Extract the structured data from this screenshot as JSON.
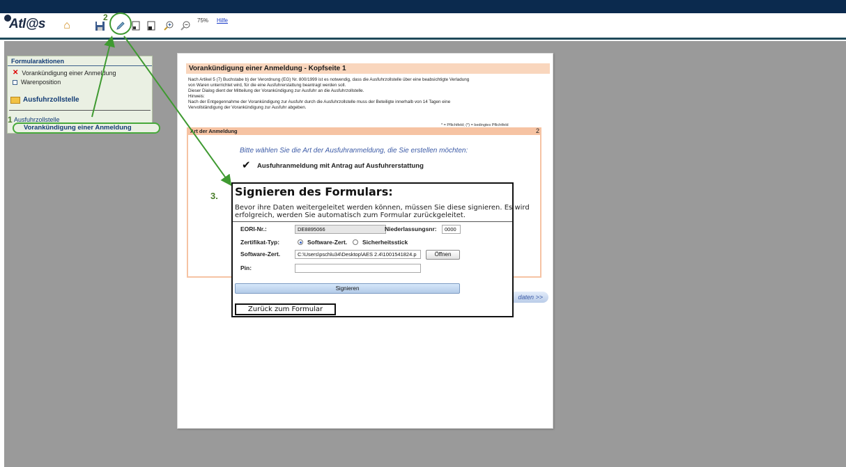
{
  "app": {
    "logo": "Atl@s"
  },
  "toolbar": {
    "zoom": "75%",
    "help": "Hilfe"
  },
  "sidebar": {
    "header": "Formularaktionen",
    "items": [
      {
        "label": "Vorankündigung einer Anmeldung",
        "icon": "delete-x-icon"
      },
      {
        "label": "Warenposition",
        "icon": "checkbox-icon"
      }
    ],
    "section": "Ausfuhrzollstelle",
    "tree_parent": "Ausfuhrzollstelle",
    "tree_active": "Vorankündigung einer Anmeldung"
  },
  "callouts": {
    "one": "1",
    "two": "2",
    "three": "3."
  },
  "document": {
    "title": "Vorankündigung einer Anmeldung - Kopfseite 1",
    "paragraphs": [
      "Nach Artikel 5 (7) Buchstabe b) der Verordnung (EG) Nr. 800/1999 ist es notwendig, dass die Ausfuhrzollstelle über eine beabsichtigte Verladung",
      "von Waren unterrichtet wird, für die eine Ausfuhrerstattung beantragt werden soll.",
      "Dieser Dialog dient der Mitteilung der Vorankündigung zur Ausfuhr an die Ausfuhrzollstelle.",
      "Hinweis:",
      "Nach der Entgegennahme der Vorankündigung zur Ausfuhr durch die Ausfuhrzollstelle muss der Beteiligte innerhalb von 14 Tagen eine",
      "Vervollständigung der Vorankündigung zur Ausfuhr abgeben."
    ],
    "required_note": "* = Pflichtfeld; (*) = bedingtes Pflichtfeld",
    "section_title": "Art der Anmeldung",
    "section_number": "2",
    "prompt": "Bitte wählen Sie die Art der Ausfuhranmeldung, die Sie erstellen möchten:",
    "option": "Ausfuhranmeldung mit Antrag auf Ausfuhrerstattung",
    "next_link": "daten >>"
  },
  "dialog": {
    "title": "Signieren des Formulars:",
    "desc_lines": [
      "Bevor ihre Daten weitergeleitet werden können, müssen Sie diese signieren. Es wird",
      "erfolgreich, werden Sie automatisch zum Formular zurückgeleitet."
    ],
    "eori_label": "EORI-Nr.:",
    "eori_value": "DE8895066",
    "niederlassung_label": "Niederlassungsnr:",
    "niederlassung_value": "0000",
    "zertifikat_label": "Zertifikat-Typ:",
    "radio_software": "Software-Zert.",
    "radio_stick": "Sicherheitsstick",
    "software_label": "Software-Zert.",
    "software_value": "C:\\Users\\pschlu34\\Desktop\\AES 2.4\\1001541824.p",
    "open_button": "Öffnen",
    "pin_label": "Pin:",
    "pin_value": "",
    "sign_button": "Signieren",
    "back_button": "Zurück zum Formular"
  },
  "colors": {
    "topbar": "#0b2a4e",
    "workspace": "#9a9a9a",
    "sidebar_bg": "#eaf0e3",
    "doc_title_bg": "#f9d6bd",
    "section_bg": "#f6c3a3",
    "callout_green": "#46a83a"
  }
}
